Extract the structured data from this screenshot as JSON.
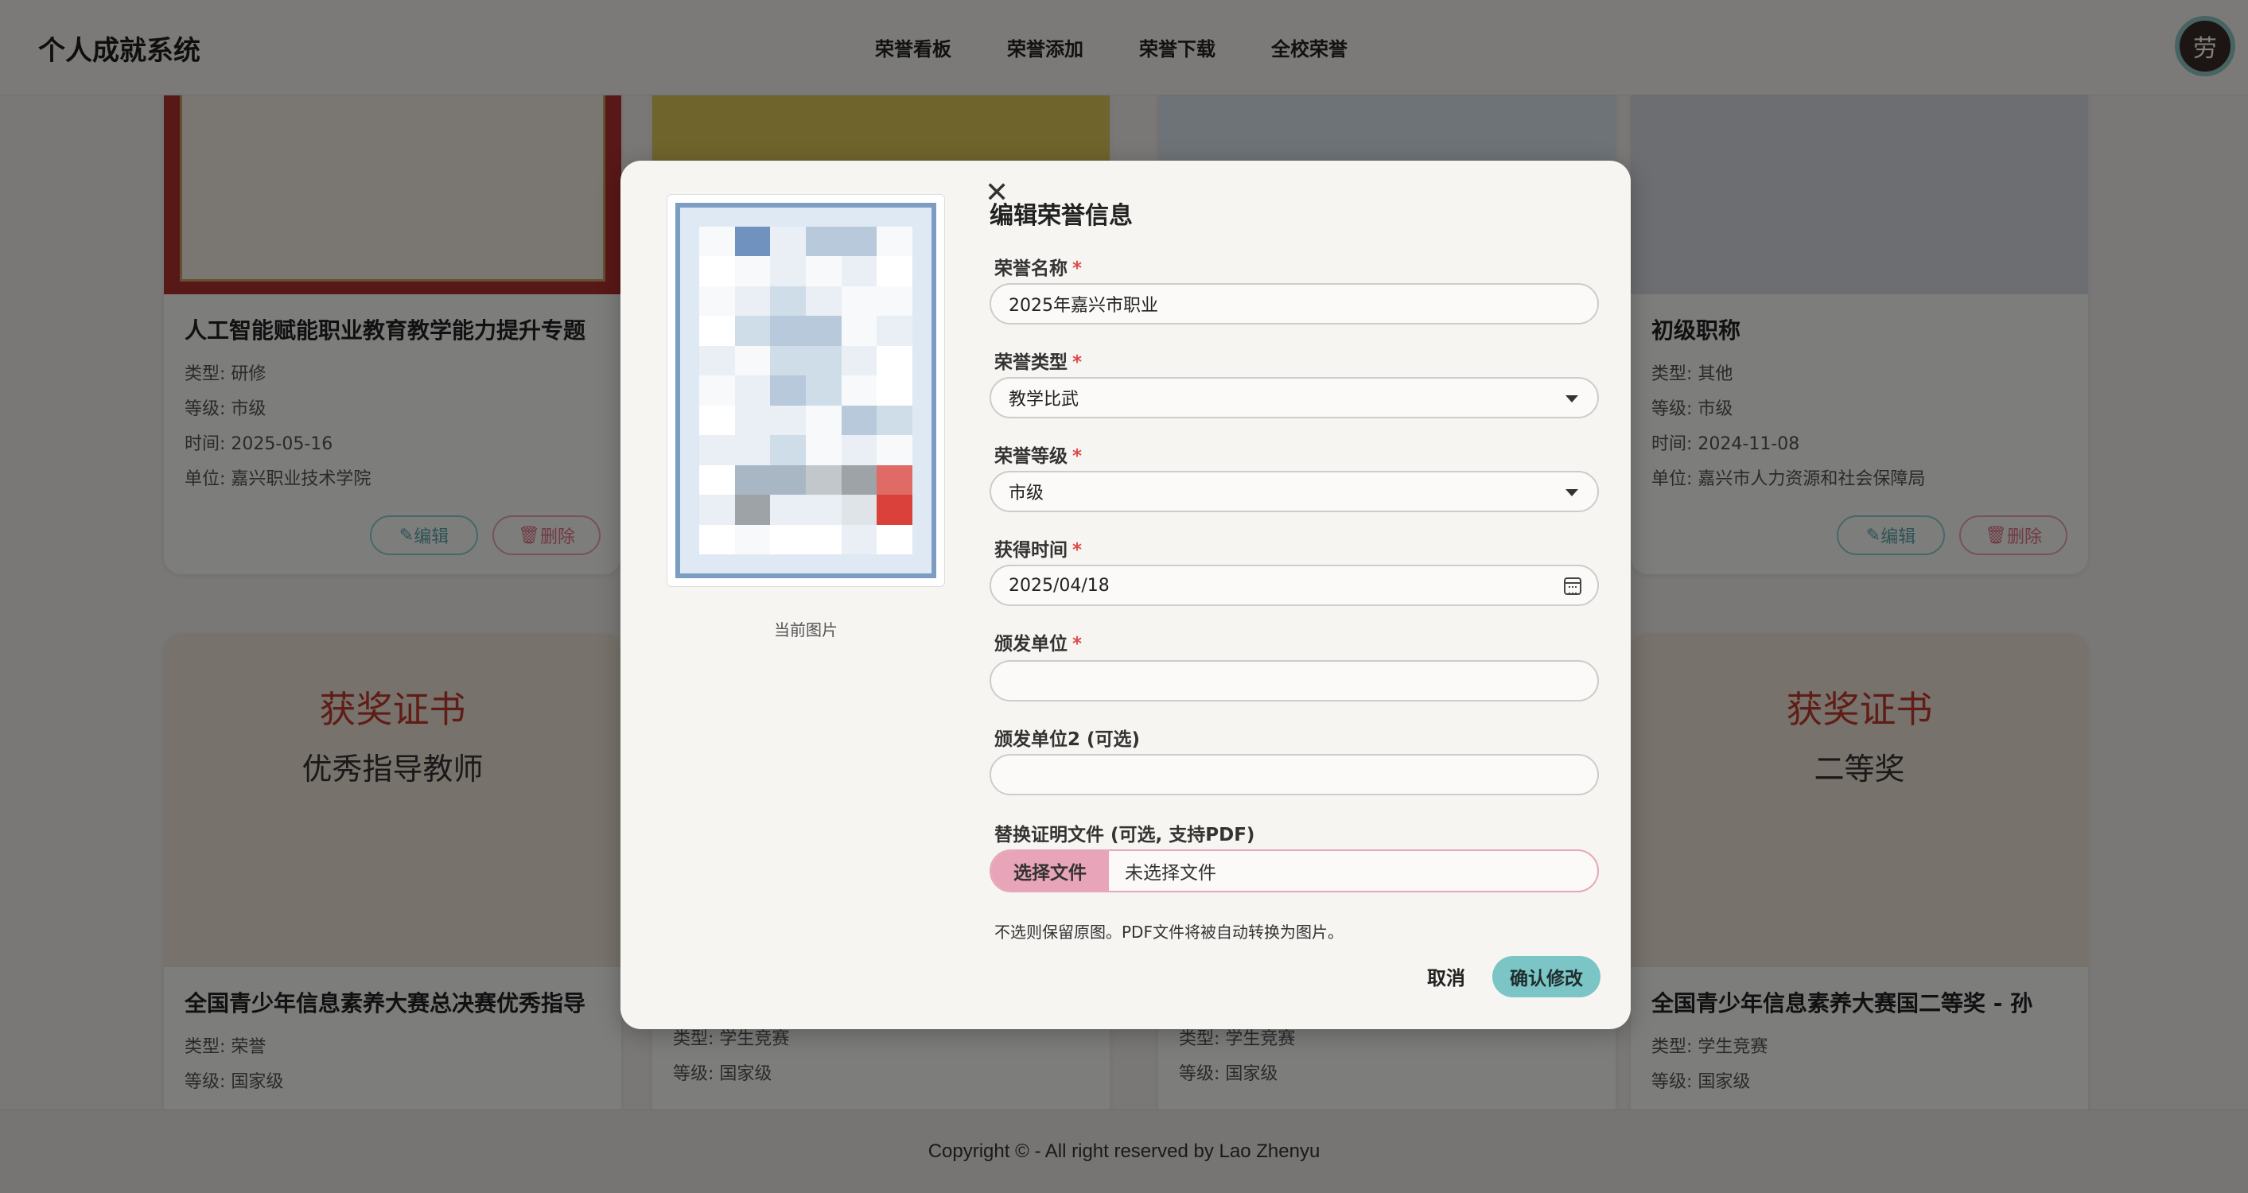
{
  "header": {
    "brand": "个人成就系统",
    "nav": [
      "荣誉看板",
      "荣誉添加",
      "荣誉下载",
      "全校荣誉"
    ],
    "avatar_text": "劳"
  },
  "cards": [
    {
      "title": "人工智能赋能职业教育教学能力提升专题",
      "type": "类型: 研修",
      "level": "等级: 市级",
      "date": "时间: 2025-05-16",
      "unit": "单位: 嘉兴职业技术学院",
      "edit": "编辑",
      "delete": "删除"
    },
    {
      "title": "初级职称",
      "type": "类型: 其他",
      "level": "等级: 市级",
      "date": "时间: 2024-11-08",
      "unit": "单位: 嘉兴市人力资源和社会保障局",
      "edit": "编辑",
      "delete": "删除"
    },
    {
      "title": "全国青少年信息素养大赛总决赛优秀指导",
      "type": "类型: 荣誉",
      "level": "等级: 国家级",
      "cert_title": "获奖证书",
      "cert_sub": "优秀指导教师"
    },
    {
      "type": "类型: 学生竞赛",
      "level": "等级: 国家级"
    },
    {
      "type": "类型: 学生竞赛",
      "level": "等级: 国家级"
    },
    {
      "title": "全国青少年信息素养大赛国二等奖 - 孙",
      "type": "类型: 学生竞赛",
      "level": "等级: 国家级",
      "cert_title": "获奖证书",
      "cert_sub": "二等奖"
    }
  ],
  "footer": "Copyright © - All right reserved by Lao Zhenyu",
  "modal": {
    "title": "编辑荣誉信息",
    "preview_caption": "当前图片",
    "fields": {
      "name": {
        "label": "荣誉名称",
        "value": "2025年嘉兴市职业"
      },
      "type": {
        "label": "荣誉类型",
        "value": "教学比武"
      },
      "level": {
        "label": "荣誉等级",
        "value": "市级"
      },
      "date": {
        "label": "获得时间",
        "value": "2025/04/18"
      },
      "issuer": {
        "label": "颁发单位",
        "value": ""
      },
      "issuer2": {
        "label": "颁发单位2 (可选)",
        "value": ""
      },
      "file": {
        "label": "替换证明文件 (可选, 支持PDF)",
        "button": "选择文件",
        "value": "未选择文件"
      }
    },
    "hint": "不选则保留原图。PDF文件将被自动转换为图片。",
    "cancel": "取消",
    "confirm": "确认修改",
    "required_mark": "*"
  },
  "colors": {
    "accent_teal": "#7cc5c6",
    "accent_pink": "#e8a4b8",
    "required_red": "#e04a4a"
  }
}
